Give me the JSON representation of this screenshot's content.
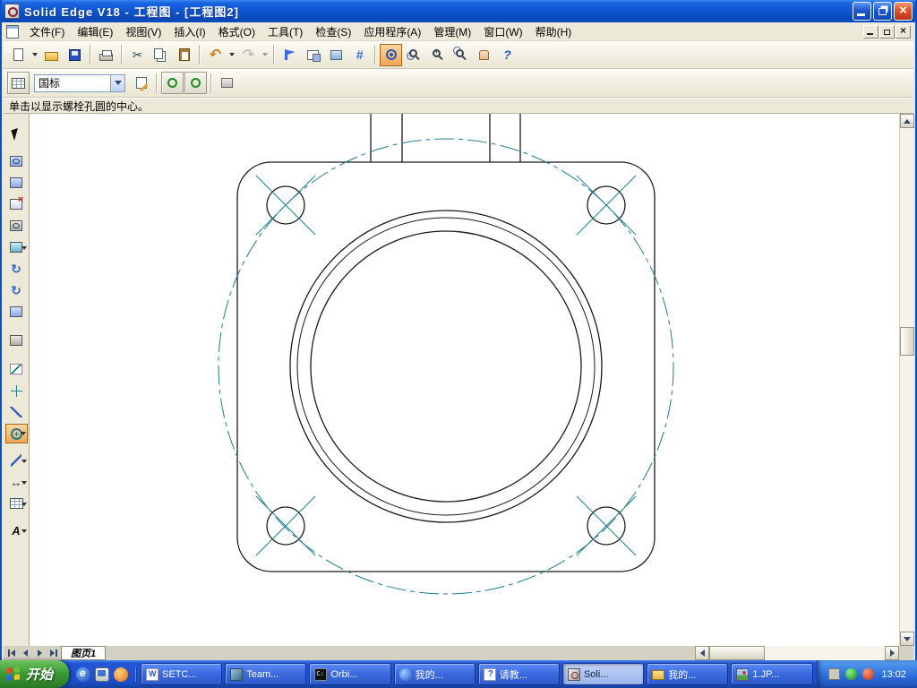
{
  "window": {
    "title": "Solid Edge V18 - 工程图 - [工程图2]",
    "caption_buttons": [
      "minimize",
      "restore",
      "close"
    ]
  },
  "menu": {
    "items": [
      "文件(F)",
      "编辑(E)",
      "视图(V)",
      "插入(I)",
      "格式(O)",
      "工具(T)",
      "检查(S)",
      "应用程序(A)",
      "管理(M)",
      "窗口(W)",
      "帮助(H)"
    ],
    "mdi_buttons": [
      "minimize",
      "restore",
      "close"
    ]
  },
  "toolbar_main": {
    "icons": [
      "new",
      "new-dropdown",
      "open",
      "save",
      "print",
      "cut",
      "copy",
      "paste",
      "undo",
      "undo-dropdown",
      "redo",
      "redo-dropdown",
      "last-view",
      "sheet-setup",
      "background-sheet",
      "grid",
      "bolt-hole-circle-active",
      "zoom-area",
      "zoom-in",
      "fit-sheet",
      "pan",
      "context-help"
    ]
  },
  "toolbar_style": {
    "combo_value": "国标",
    "icons": [
      "table",
      "style-edit",
      "center-ring-1",
      "center-ring-2",
      "options"
    ]
  },
  "prompt": {
    "text": "单击以显示螺栓孔圆的中心。"
  },
  "tools_left": {
    "items": [
      "select",
      "view-wizard",
      "principal-view",
      "section-view",
      "detail-view",
      "views-flyout",
      "update-views",
      "drawing-view",
      "sheet-align",
      "parts-list",
      "centerline",
      "center-mark",
      "angle-line",
      "bolt-circle-active",
      "connector",
      "smart-dimension",
      "table-tool",
      "text"
    ]
  },
  "canvas": {
    "view": "flange-top-view-with-bolt-circle"
  },
  "sheet_bar": {
    "tab": "图页1"
  },
  "taskbar": {
    "start": "开始",
    "quick_launch": [
      "internet-explorer",
      "show-desktop",
      "media-player"
    ],
    "tasks": [
      {
        "label": "SETC...",
        "icon": "word-doc"
      },
      {
        "label": "Team...",
        "icon": "teamcenter"
      },
      {
        "label": "Orbi...",
        "icon": "command-prompt"
      },
      {
        "label": "我的...",
        "icon": "network-globe"
      },
      {
        "label": "请教...",
        "icon": "web-page"
      },
      {
        "label": "Soli...",
        "icon": "solid-edge",
        "active": true
      },
      {
        "label": "我的...",
        "icon": "folder"
      },
      {
        "label": "1.JP...",
        "icon": "image-file"
      }
    ],
    "tray": {
      "icons": [
        "tray-gray",
        "tray-green",
        "tray-red"
      ],
      "clock": "13:02"
    }
  },
  "colors": {
    "titlebar_blue": "#0c52cc",
    "taskbar_blue": "#1e4ec6",
    "start_green": "#3c9c36",
    "active_tool_orange": "#f0a658",
    "centerline_teal": "#1d7f8e",
    "geometry_black": "#1a1a1a"
  }
}
